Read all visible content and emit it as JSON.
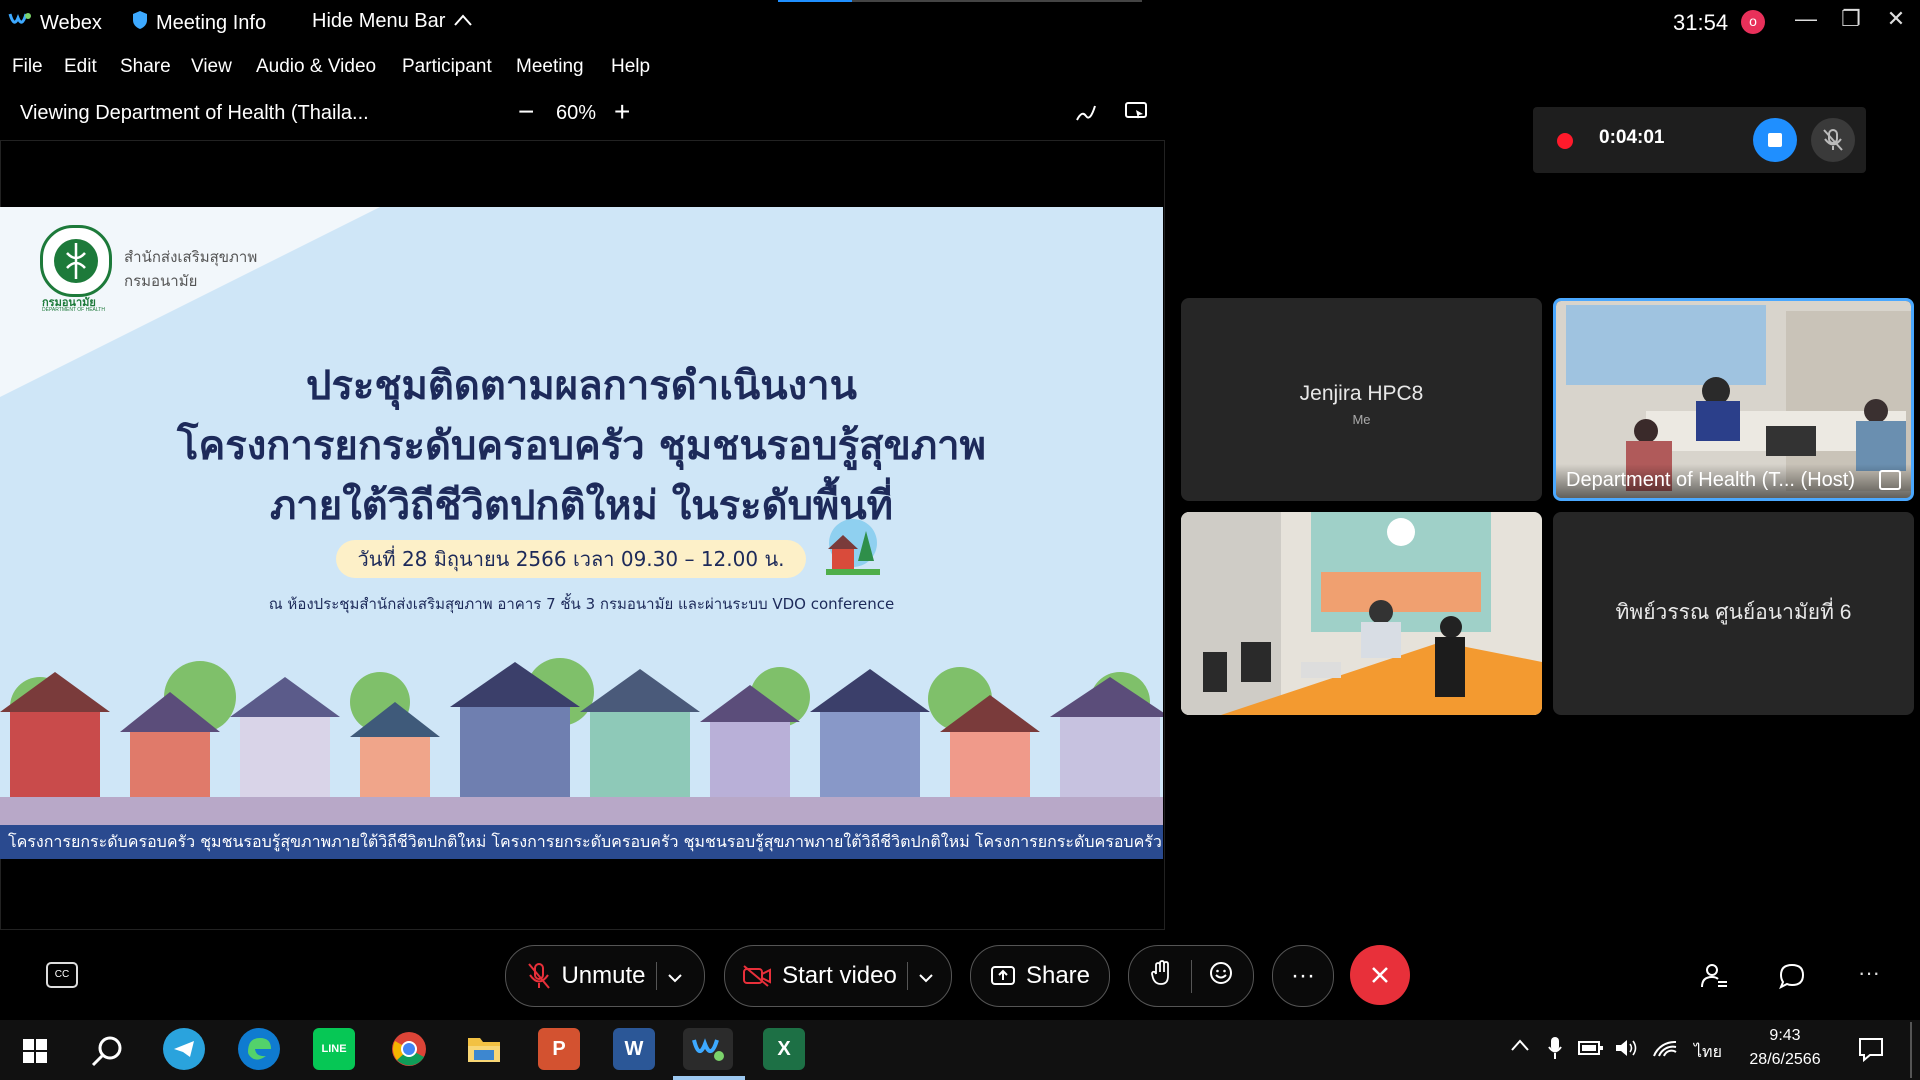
{
  "titlebar": {
    "app_name": "Webex",
    "meeting_info": "Meeting Info",
    "hide_menu_bar": "Hide Menu Bar",
    "timer": "31:54",
    "rec_badge": "o"
  },
  "menu": [
    "File",
    "Edit",
    "Share",
    "View",
    "Audio & Video",
    "Participant",
    "Meeting",
    "Help"
  ],
  "viewbar": {
    "viewing": "Viewing Department of Health (Thaila...",
    "zoom": "60%",
    "zoom_out": "−",
    "zoom_in": "+"
  },
  "slide": {
    "org_line1": "สำนักส่งเสริมสุขภาพ",
    "org_line2": "กรมอนามัย",
    "logo_text": "กรมอนามัย",
    "logo_sub": "DEPARTMENT OF HEALTH",
    "title1": "ประชุมติดตามผลการดำเนินงาน",
    "title2": "โครงการยกระดับครอบครัว ชุมชนรอบรู้สุขภาพ",
    "title3": "ภายใต้วิถีชีวิตปกติใหม่ ในระดับพื้นที่",
    "date_line": "วันที่ 28 มิถุนายน 2566 เวลา 09.30 – 12.00 น.",
    "venue_line": "ณ ห้องประชุมสำนักส่งเสริมสุขภาพ อาคาร 7 ชั้น 3 กรมอนามัย และผ่านระบบ VDO conference",
    "ticker": "โครงการยกระดับครอบครัว ชุมชนรอบรู้สุขภาพภายใต้วิถีชีวิตปกติใหม่  โครงการยกระดับครอบครัว ชุมชนรอบรู้สุขภาพภายใต้วิถีชีวิตปกติใหม่  โครงการยกระดับครอบครัว ชุมชนรอบรู้สุขภ"
  },
  "recording": {
    "elapsed": "0:04:01"
  },
  "participants": {
    "me_name": "Jenjira HPC8",
    "me_label": "Me",
    "host_label": "Department of Health (T... (Host)",
    "p4_name": "ทิพย์วรรณ ศูนย์อนามัยที่ 6"
  },
  "controls": {
    "unmute": "Unmute",
    "start_video": "Start video",
    "share": "Share",
    "more": "···",
    "cc": "CC"
  },
  "taskbar": {
    "time": "9:43",
    "date": "28/6/2566",
    "lang": "ไทย"
  },
  "colors": {
    "accent": "#1f8fff",
    "end_call": "#e8303a",
    "record": "#ff1a2b",
    "slide_bg": "#cfe6f7",
    "ticker_bg": "#2a4a8f"
  }
}
